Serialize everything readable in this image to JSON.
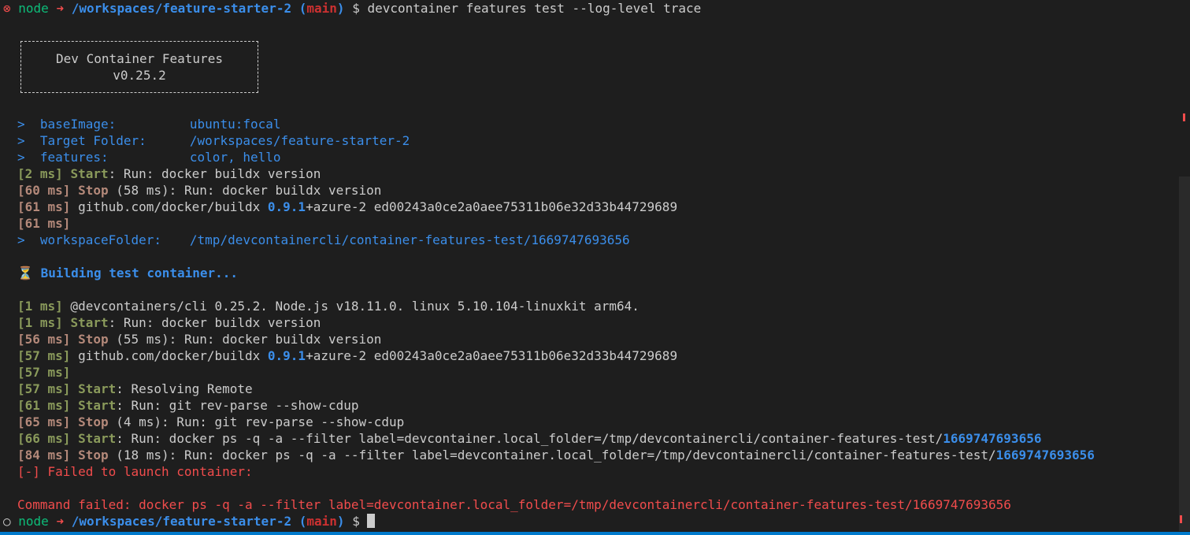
{
  "prompt": {
    "status_fail": "⊗",
    "status_ok": "○",
    "user": "node",
    "arrow": "➜",
    "path": "/workspaces/feature-starter-2",
    "branch_open": "(",
    "branch": "main",
    "branch_close": ")",
    "dollar": "$",
    "command": "devcontainer features test --log-level trace"
  },
  "banner": {
    "title": "Dev Container Features",
    "version": "v0.25.2"
  },
  "config": [
    {
      "marker": ">",
      "key": "baseImage:",
      "value": "ubuntu:focal"
    },
    {
      "marker": ">",
      "key": "Target Folder:",
      "value": "/workspaces/feature-starter-2"
    },
    {
      "marker": ">",
      "key": "features:",
      "value": "color, hello"
    }
  ],
  "log1": {
    "l1_ms": "[2 ms]",
    "l1_tag": "Start",
    "l1_text": ": Run: docker buildx version",
    "l2_ms": "[60 ms]",
    "l2_tag": "Stop",
    "l2_text": " (58 ms): Run: docker buildx version",
    "l3_ms": "[61 ms]",
    "l3_pre": " github.com/docker/buildx ",
    "l3_ver": "0.9.1",
    "l3_post": "+azure-2 ed00243a0ce2a0aee75311b06e32d33b44729689",
    "l4_ms": "[61 ms]"
  },
  "workspace": {
    "marker": ">",
    "key": "workspaceFolder:",
    "value": "/tmp/devcontainercli/container-features-test/1669747693656"
  },
  "building": {
    "icon": "⏳",
    "text": "Building test container..."
  },
  "log2": {
    "a_ms": "[1 ms]",
    "a_text": " @devcontainers/cli 0.25.2. Node.js v18.11.0. linux 5.10.104-linuxkit arm64.",
    "b_ms": "[1 ms]",
    "b_tag": "Start",
    "b_text": ": Run: docker buildx version",
    "c_ms": "[56 ms]",
    "c_tag": "Stop",
    "c_text": " (55 ms): Run: docker buildx version",
    "d_ms": "[57 ms]",
    "d_pre": " github.com/docker/buildx ",
    "d_ver": "0.9.1",
    "d_post": "+azure-2 ed00243a0ce2a0aee75311b06e32d33b44729689",
    "e_ms": "[57 ms]",
    "f_ms": "[57 ms]",
    "f_tag": "Start",
    "f_text": ": Resolving Remote",
    "g_ms": "[61 ms]",
    "g_tag": "Start",
    "g_text": ": Run: git rev-parse --show-cdup",
    "h_ms": "[65 ms]",
    "h_tag": "Stop",
    "h_text": " (4 ms): Run: git rev-parse --show-cdup",
    "i_ms": "[66 ms]",
    "i_tag": "Start",
    "i_text": ": Run: docker ps -q -a --filter label=devcontainer.local_folder=/tmp/devcontainercli/container-features-test/",
    "i_id": "1669747693656",
    "j_ms": "[84 ms]",
    "j_tag": "Stop",
    "j_text": " (18 ms): Run: docker ps -q -a --filter label=devcontainer.local_folder=/tmp/devcontainercli/container-features-test/",
    "j_id": "1669747693656"
  },
  "error": {
    "failed": "[-] Failed to launch container:",
    "command_failed": "Command failed: docker ps -q -a --filter label=devcontainer.local_folder=/tmp/devcontainercli/container-features-test/1669747693656"
  }
}
